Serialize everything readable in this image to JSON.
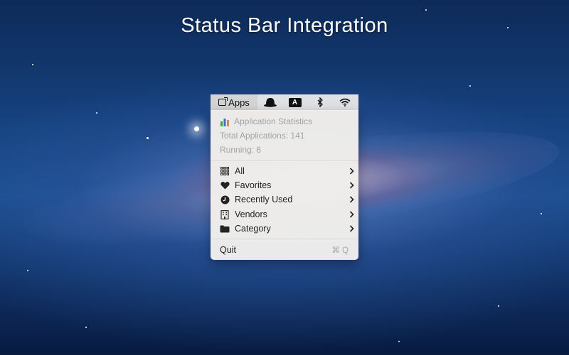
{
  "headline": "Status Bar Integration",
  "menubar": {
    "apps_label": "Apps",
    "icons": [
      "app-status-icon",
      "bowler-hat-icon",
      "input-source-a-icon",
      "bluetooth-icon",
      "wifi-icon"
    ],
    "input_source_letter": "A"
  },
  "menu": {
    "stats": {
      "title": "Application Statistics",
      "total": "Total Applications: 141",
      "running": "Running: 6"
    },
    "items": [
      {
        "label": "All",
        "icon": "grid-icon"
      },
      {
        "label": "Favorites",
        "icon": "heart-icon"
      },
      {
        "label": "Recently Used",
        "icon": "clock-icon"
      },
      {
        "label": "Vendors",
        "icon": "building-icon"
      },
      {
        "label": "Category",
        "icon": "folder-icon"
      }
    ],
    "quit": {
      "label": "Quit",
      "shortcut": "⌘ Q"
    }
  },
  "colors": {
    "menu_background": "#f2f0ec",
    "menubar_background": "#e8e8e8",
    "disabled_text": "#a3a3a3",
    "chart_green": "#3aa64a",
    "chart_blue": "#3b6fd8",
    "chart_orange": "#e3892b"
  }
}
